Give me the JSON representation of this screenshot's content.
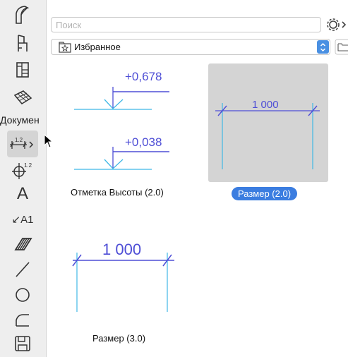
{
  "toolbar": {
    "section_label": "Докумен",
    "tools": [
      {
        "icon": "wall-icon"
      },
      {
        "icon": "chair-icon"
      },
      {
        "icon": "stair-icon"
      },
      {
        "icon": "mesh-icon"
      },
      {
        "icon": "linear-dimension-icon",
        "active": true
      },
      {
        "icon": "level-dimension-icon"
      },
      {
        "icon": "text-icon"
      },
      {
        "icon": "label-icon",
        "glyph": "A1"
      },
      {
        "icon": "fill-icon"
      },
      {
        "icon": "line-icon"
      },
      {
        "icon": "circle-icon"
      },
      {
        "icon": "polyline-icon"
      },
      {
        "icon": "drawing-icon"
      }
    ],
    "text_tool_glyph": "A",
    "dimension_glyph": "1.2"
  },
  "search": {
    "placeholder": "Поиск",
    "value": ""
  },
  "favorites": {
    "selected": "Избранное"
  },
  "items": [
    {
      "name": "Отметка Высоты (2.0)",
      "values": [
        "+0,678",
        "+0,038"
      ],
      "selected": false
    },
    {
      "name": "Размер (2.0)",
      "value": "1 000",
      "selected": true
    },
    {
      "name": "Размер (3.0)",
      "value": "1 000",
      "selected": false
    }
  ],
  "colors": {
    "dimension_blue": "#4e4ed6",
    "line_cyan": "#3fb8e6",
    "selection_blue": "#3b7de0",
    "toolbar_bg": "#eeeeee"
  }
}
